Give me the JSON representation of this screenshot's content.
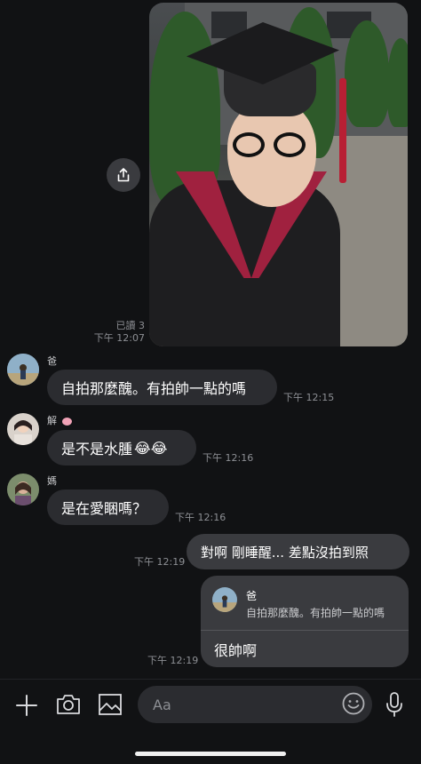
{
  "messages": {
    "photo": {
      "read_receipt": "已讀 3",
      "time": "下午 12:07"
    },
    "msg1": {
      "sender": "爸",
      "text": "自拍那麼醜。有拍帥一點的嗎",
      "time": "下午 12:15"
    },
    "msg2": {
      "sender": "解",
      "text": "是不是水腫",
      "emoji": "😂😂",
      "time": "下午 12:16"
    },
    "msg3": {
      "sender": "媽",
      "text": "是在愛睏嗎？",
      "time": "下午 12:16"
    },
    "out1": {
      "text": "對啊 剛睡醒... 差點沒拍到照",
      "time": "下午 12:19"
    },
    "out2": {
      "quote_sender": "爸",
      "quote_text": "自拍那麼醜。有拍帥一點的嗎",
      "text": "很帥啊",
      "time": "下午 12:19"
    }
  },
  "composer": {
    "placeholder": "Aa"
  },
  "colors": {
    "background": "#111214",
    "bubble_in": "#2b2c30",
    "bubble_out": "#3a3b3f",
    "sash": "#a0213f"
  }
}
